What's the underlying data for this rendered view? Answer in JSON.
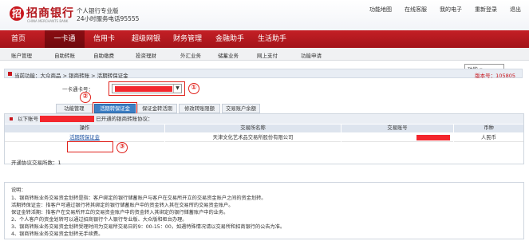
{
  "header": {
    "logo_char": "招",
    "bank_name": "招商银行",
    "bank_en": "CHINA MERCHANTS BANK",
    "sub1": "个人银行专业版",
    "sub2": "24小时服务电话95555",
    "links": [
      "功能地图",
      "在线客服",
      "我的电子",
      "重新登录",
      "退出"
    ]
  },
  "nav": {
    "items": [
      "首页",
      "一卡通",
      "信用卡",
      "超级网银",
      "财务管理",
      "金融助手",
      "生活助手"
    ],
    "func_label": "功能 ▾",
    "settings": "设置"
  },
  "subnav": [
    "账户管理",
    "自助转账",
    "自助缴费",
    "投资理财",
    "外汇业务",
    "储蓄业务",
    "网上支付",
    "功能申请"
  ],
  "breadcrumb": {
    "text": "当前功能：大众商品 > 银商转账 > 活期转保证金",
    "version": "版本号：105805"
  },
  "card_field": {
    "label": "一卡通卡号："
  },
  "tabs": [
    "功能管理",
    "活期转保证金",
    "保证金转活期",
    "修改转账限额",
    "交易账户余额"
  ],
  "panel": {
    "head_prefix": "以下账号",
    "head_suffix": "已开通的银商转账协议：",
    "columns": [
      "操作",
      "交易所名称",
      "交易账号",
      "币种"
    ],
    "rows": [
      {
        "action": "活期转保证金",
        "exchange": "天津文化艺术品交易所股份有限公司",
        "currency": "人民币"
      }
    ],
    "count": "开通协议交易所数：1"
  },
  "annotations": [
    "①",
    "②",
    "③"
  ],
  "notes": [
    "说明：",
    "1、银商转账业务交易资金划转是指：客户绑定的银行储蓄账户与客户在交易所开立的交易资金账户之间的资金划转。",
    "   活期转保证金：指客户可通过银行将其绑定的银行储蓄账户中的资金转入其在交易所的交易资金账户。",
    "   保证金转活期：指客户在交易所开立的交易资金账户中的资金转入其绑定的银行储蓄账户中的业务。",
    "2、个人客户的资金划转可以通过招商银行个人银行专业版、大众版和柜台办理。",
    "3、银商转账业务交易资金划转受理时间为交易所交易日的9：00-15：00，如遇特殊情况请以交易所和招商银行的公告为准。",
    "4、银商转账业务交易资金划转无手续费。"
  ],
  "colors": {
    "brand_red": "#c8161d",
    "annotation_red": "#e0221c",
    "tab_blue": "#3d7fc4"
  }
}
